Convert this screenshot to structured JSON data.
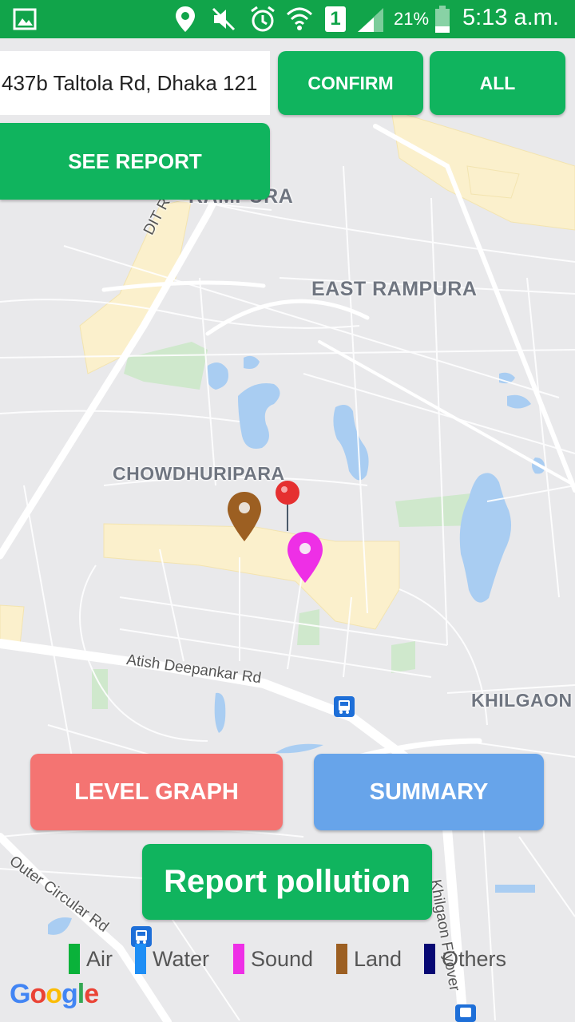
{
  "status_bar": {
    "battery_percent": "21%",
    "time": "5:13 a.m.",
    "sim_slot": "1",
    "icons": [
      "gallery-icon",
      "location-icon",
      "mute-icon",
      "alarm-icon",
      "wifi-icon",
      "sim-icon",
      "signal-icon",
      "battery-icon"
    ]
  },
  "top_bar": {
    "address_value": "437b Taltola Rd, Dhaka 121",
    "confirm_label": "CONFIRM",
    "all_label": "ALL",
    "see_report_label": "SEE REPORT"
  },
  "map": {
    "area_labels": [
      "RAMPURA",
      "EAST RAMPURA",
      "CHOWDHURIPARA",
      "KHILGAON"
    ],
    "road_labels": [
      "DIT Rd",
      "Atish Deepankar Rd",
      "Outer Circular Rd",
      "Khilgaon Flyover"
    ],
    "markers": [
      {
        "type": "Land",
        "color": "#9c5f22"
      },
      {
        "type": "current-location",
        "color": "#e53030"
      },
      {
        "type": "Sound",
        "color": "#ee2fe6"
      }
    ]
  },
  "actions": {
    "level_graph_label": "LEVEL GRAPH",
    "summary_label": "SUMMARY",
    "report_pollution_label": "Report pollution"
  },
  "legend": [
    {
      "label": "Air",
      "color": "#0ab23a"
    },
    {
      "label": "Water",
      "color": "#1e8ef5"
    },
    {
      "label": "Sound",
      "color": "#ee2fe6"
    },
    {
      "label": "Land",
      "color": "#9c5f22"
    },
    {
      "label": "Others",
      "color": "#070873"
    }
  ],
  "colors": {
    "status_bar": "#11a44a",
    "primary_button": "#10b45e",
    "level_graph": "#f47472",
    "summary": "#67a4ea"
  },
  "attribution": "Google"
}
